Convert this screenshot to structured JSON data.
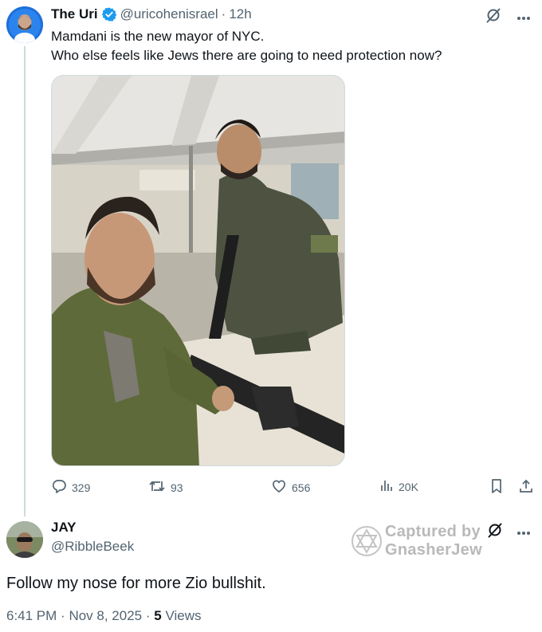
{
  "tweet": {
    "author_name": "The Uri",
    "author_handle": "@uricohenisrael",
    "separator": "·",
    "time": "12h",
    "text_line1": "Mamdani is the new mayor of NYC.",
    "text_line2": "Who else feels like Jews there are going to need protection now?",
    "verified_color": "#1d9bf0",
    "actions": {
      "replies": "329",
      "reposts": "93",
      "likes": "656",
      "views": "20K"
    },
    "icons": [
      "grok-icon",
      "more-icon",
      "reply-icon",
      "repost-icon",
      "like-icon",
      "views-icon",
      "bookmark-icon",
      "share-icon"
    ]
  },
  "reply": {
    "author_name": "JAY",
    "author_handle": "@RibbleBeek",
    "text": "Follow my nose for more Zio bullshit.",
    "time": "6:41 PM",
    "date": "Nov 8, 2025",
    "meta_separator": "·",
    "views_count": "5",
    "views_label": "Views"
  },
  "watermark": {
    "line1": "Captured by",
    "line2": "GnasherJew"
  }
}
